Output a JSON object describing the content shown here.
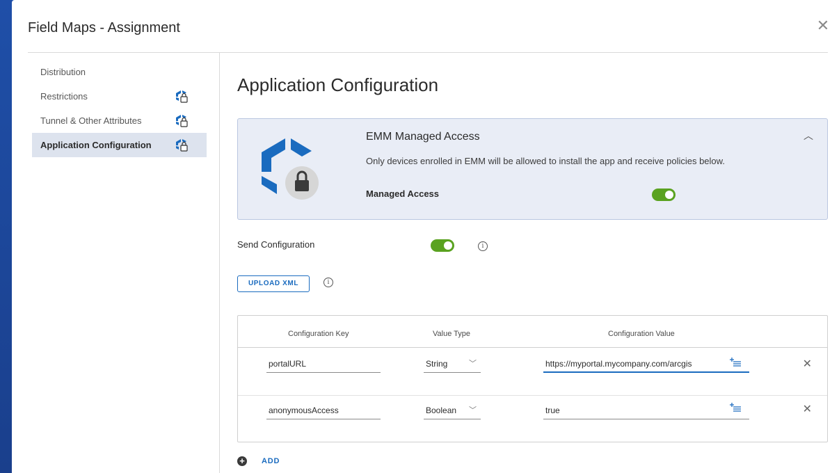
{
  "dialog": {
    "title": "Field Maps - Assignment",
    "close_icon": "close-icon"
  },
  "sidebar": {
    "items": [
      {
        "label": "Distribution",
        "locked": false,
        "active": false
      },
      {
        "label": "Restrictions",
        "locked": true,
        "active": false
      },
      {
        "label": "Tunnel & Other Attributes",
        "locked": true,
        "active": false
      },
      {
        "label": "Application Configuration",
        "locked": true,
        "active": true
      }
    ]
  },
  "main": {
    "title": "Application Configuration",
    "emm": {
      "title": "EMM Managed Access",
      "description": "Only devices enrolled in EMM will be allowed to install the app and receive policies below.",
      "managed_access_label": "Managed Access",
      "managed_access_on": true
    },
    "send_configuration": {
      "label": "Send Configuration",
      "on": true
    },
    "upload_xml_label": "UPLOAD XML",
    "table": {
      "headers": [
        "Configuration Key",
        "Value Type",
        "Configuration Value"
      ],
      "rows": [
        {
          "key": "portalURL",
          "type": "String",
          "value": "https://myportal.mycompany.com/arcgis"
        },
        {
          "key": "anonymousAccess",
          "type": "Boolean",
          "value": "true"
        }
      ]
    },
    "add_label": "ADD"
  },
  "colors": {
    "accent": "#1a6bbf",
    "toggle_on": "#5aa220",
    "active_nav_bg": "#dde3ee",
    "emm_card_bg": "#e9edf6",
    "background": "#1f4fa8"
  }
}
